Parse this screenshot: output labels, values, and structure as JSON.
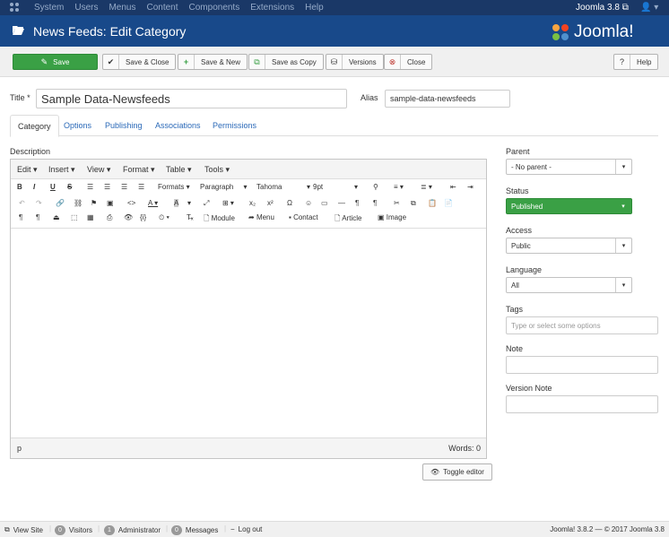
{
  "topnav": {
    "menu": [
      "System",
      "Users",
      "Menus",
      "Content",
      "Components",
      "Extensions",
      "Help"
    ],
    "version": "Joomla 3.8",
    "user_icon": "user-icon"
  },
  "header": {
    "title": "News Feeds: Edit Category",
    "brand": "Joomla!"
  },
  "toolbar": {
    "save": "Save",
    "save_close": "Save & Close",
    "save_new": "Save & New",
    "save_copy": "Save as Copy",
    "versions": "Versions",
    "close": "Close",
    "help": "Help"
  },
  "form": {
    "title_label": "Title *",
    "title_value": "Sample Data-Newsfeeds",
    "alias_label": "Alias",
    "alias_value": "sample-data-newsfeeds"
  },
  "tabs": [
    "Category",
    "Options",
    "Publishing",
    "Associations",
    "Permissions"
  ],
  "description_label": "Description",
  "editor": {
    "menus": [
      "Edit",
      "Insert",
      "View",
      "Format",
      "Table",
      "Tools"
    ],
    "formats": "Formats",
    "block": "Paragraph",
    "font": "Tahoma",
    "size": "9pt",
    "module": "Module",
    "menu": "Menu",
    "contact": "Contact",
    "article": "Article",
    "image": "Image",
    "path": "p",
    "words": "Words: 0"
  },
  "toggle_editor": "Toggle editor",
  "side": {
    "parent_label": "Parent",
    "parent_value": "- No parent -",
    "status_label": "Status",
    "status_value": "Published",
    "access_label": "Access",
    "access_value": "Public",
    "language_label": "Language",
    "language_value": "All",
    "tags_label": "Tags",
    "tags_placeholder": "Type or select some options",
    "note_label": "Note",
    "version_note_label": "Version Note"
  },
  "footer": {
    "view_site": "View Site",
    "visitors_count": "0",
    "visitors": "Visitors",
    "admin_count": "1",
    "admin": "Administrator",
    "messages_count": "0",
    "messages": "Messages",
    "logout": "Log out",
    "copyright": "Joomla! 3.8.2 — © 2017 Joomla 3.8"
  },
  "colors": {
    "nav": "#1a3867",
    "header": "#18498a",
    "save": "#3aa045",
    "published": "#3aa045"
  }
}
